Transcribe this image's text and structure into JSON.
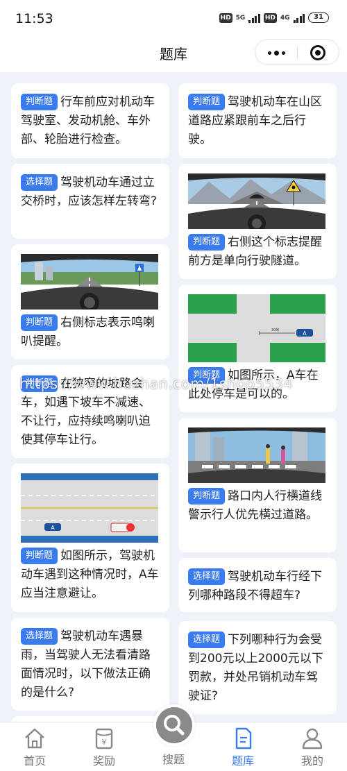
{
  "status_bar": {
    "time": "11:53",
    "hd1": "HD",
    "net1": "5G",
    "hd2": "HD",
    "net2": "4G",
    "battery": "31"
  },
  "header": {
    "title": "题库"
  },
  "questions": [
    {
      "type": "判断题",
      "text": "行车前应对机动车驾驶室、发动机舱、车外部、轮胎进行检查。"
    },
    {
      "type": "判断题",
      "text": "驾驶机动车在山区道路应紧跟前车之后行驶。"
    },
    {
      "type": "选择题",
      "text": "驾驶机动车通过立交桥时，应该怎样左转弯?"
    },
    {
      "type": "判断题",
      "text": "右侧这个标志提醒前方是单向行驶隧道。"
    },
    {
      "type": "判断题",
      "text": "右侧标志表示鸣喇叭提醒。"
    },
    {
      "type": "判断题",
      "text": "如图所示，A车在此处停车是可以的。"
    },
    {
      "type": "判断题",
      "text": "在狭窄的坡路会车，如遇下坡车不减速、不让行，应持续鸣喇叭迫使其停车让行。"
    },
    {
      "type": "判断题",
      "text": "路口内人行横道线警示行人优先横过道路。"
    },
    {
      "type": "判断题",
      "text": "如图所示，驾驶机动车遇到这种情况时，A车应当注意避让。"
    },
    {
      "type": "选择题",
      "text": "驾驶机动车行经下列哪种路段不得超车?"
    },
    {
      "type": "选择题",
      "text": "驾驶机动车遇暴雨，当驾驶人无法看清路面情况时，以下做法正确的是什么?"
    },
    {
      "type": "选择题",
      "text": "下列哪种行为会受到200元以上2000元以下罚款，并处吊销机动车驾驶证?"
    }
  ],
  "image_labels": {
    "car_a": "A",
    "dist": "30米"
  },
  "watermark": "https://www.huzhan.com/1shop5534",
  "tabs": [
    {
      "label": "首页",
      "icon": "home-icon"
    },
    {
      "label": "奖励",
      "icon": "reward-icon"
    },
    {
      "label": "搜题",
      "icon": "search-icon"
    },
    {
      "label": "题库",
      "icon": "question-bank-icon"
    },
    {
      "label": "我的",
      "icon": "profile-icon"
    }
  ],
  "colors": {
    "accent": "#3a7bf0",
    "tag_bg": "#3a7bf0",
    "page_bg": "#eef2f9",
    "inactive": "#777777"
  }
}
